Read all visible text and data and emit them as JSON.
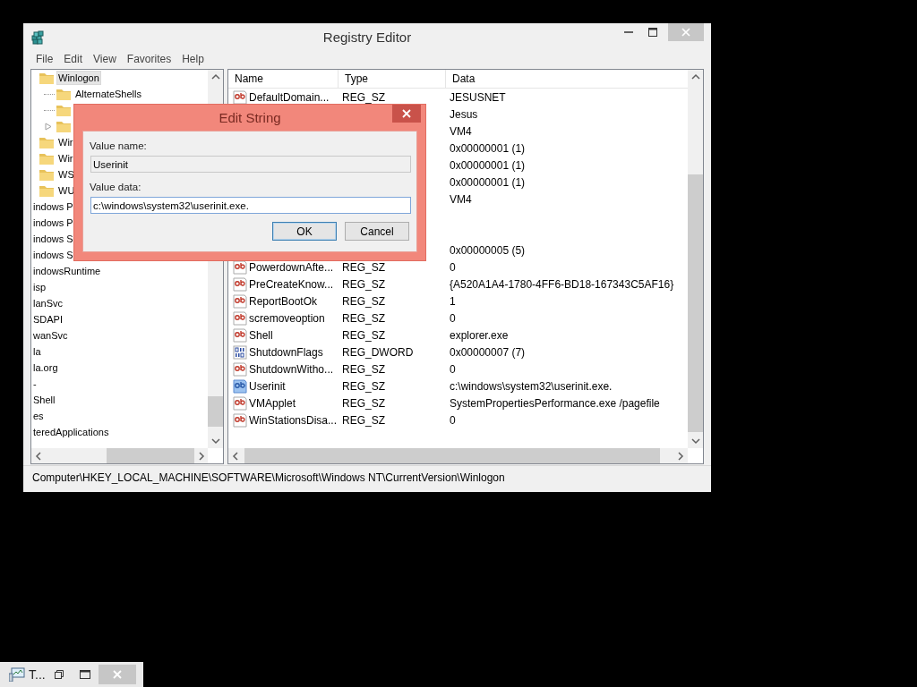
{
  "window": {
    "title": "Registry Editor"
  },
  "menu": [
    "File",
    "Edit",
    "View",
    "Favorites",
    "Help"
  ],
  "tree": {
    "items": [
      {
        "label": "Winlogon",
        "selected": true,
        "children": [
          {
            "label": "AlternateShells",
            "selected": false,
            "expandable": false
          },
          {
            "selected": false,
            "expandable": false
          },
          {
            "selected": false,
            "expandable": true
          }
        ]
      },
      {
        "label": "Wir",
        "selected": false
      },
      {
        "label": "Wir",
        "selected": false
      },
      {
        "label": "WS",
        "selected": false
      },
      {
        "label": "WU",
        "selected": false
      }
    ],
    "outer_items": [
      {
        "label": "indows P",
        "selected": false
      },
      {
        "label": "indows P",
        "selected": false
      },
      {
        "label": "indows S",
        "selected": false
      },
      {
        "label": "indows S",
        "selected": false
      },
      {
        "label": "indowsRuntime",
        "selected": false
      },
      {
        "label": "isp",
        "selected": false
      },
      {
        "label": "lanSvc",
        "selected": false
      },
      {
        "label": "SDAPI",
        "selected": false
      },
      {
        "label": "wanSvc",
        "selected": false
      },
      {
        "label": "la",
        "selected": false
      },
      {
        "label": "la.org",
        "selected": false
      },
      {
        "label": "-",
        "selected": false
      },
      {
        "label": "Shell",
        "selected": false
      },
      {
        "label": "es",
        "selected": false
      },
      {
        "label": "teredApplications",
        "selected": false
      }
    ]
  },
  "list": {
    "columns": [
      "Name",
      "Type",
      "Data"
    ],
    "rows": [
      {
        "kind": "string",
        "name": "DefaultDomain...",
        "type": "REG_SZ",
        "data": "JESUSNET",
        "selected": false
      },
      {
        "data": "Jesus"
      },
      {
        "data": "VM4"
      },
      {
        "data": "0x00000001 (1)"
      },
      {
        "data": "0x00000001 (1)"
      },
      {
        "data": "0x00000001 (1)"
      },
      {
        "data": "VM4"
      },
      {
        "kind": "hidden"
      },
      {
        "kind": "hidden"
      },
      {
        "data": "0x00000005 (5)"
      },
      {
        "kind": "string",
        "name": "PowerdownAfte...",
        "type": "REG_SZ",
        "data": "0",
        "selected": false
      },
      {
        "kind": "string",
        "name": "PreCreateKnow...",
        "type": "REG_SZ",
        "data": "{A520A1A4-1780-4FF6-BD18-167343C5AF16}",
        "selected": false
      },
      {
        "kind": "string",
        "name": "ReportBootOk",
        "type": "REG_SZ",
        "data": "1",
        "selected": false
      },
      {
        "kind": "string",
        "name": "scremoveoption",
        "type": "REG_SZ",
        "data": "0",
        "selected": false
      },
      {
        "kind": "string",
        "name": "Shell",
        "type": "REG_SZ",
        "data": "explorer.exe",
        "selected": false
      },
      {
        "kind": "binary",
        "name": "ShutdownFlags",
        "type": "REG_DWORD",
        "data": "0x00000007 (7)",
        "selected": false
      },
      {
        "kind": "string",
        "name": "ShutdownWitho...",
        "type": "REG_SZ",
        "data": "0",
        "selected": false
      },
      {
        "kind": "string",
        "name": "Userinit",
        "type": "REG_SZ",
        "data": "c:\\windows\\system32\\userinit.exe.",
        "selected": true
      },
      {
        "kind": "string",
        "name": "VMApplet",
        "type": "REG_SZ",
        "data": "SystemPropertiesPerformance.exe /pagefile",
        "selected": false
      },
      {
        "kind": "string",
        "name": "WinStationsDisa...",
        "type": "REG_SZ",
        "data": "0",
        "selected": false
      }
    ]
  },
  "status_bar": "Computer\\HKEY_LOCAL_MACHINE\\SOFTWARE\\Microsoft\\Windows NT\\CurrentVersion\\Winlogon",
  "dialog": {
    "title": "Edit String",
    "fields": [
      {
        "label": "Value name:",
        "value": "Userinit",
        "readonly": true
      },
      {
        "label": "Value data:",
        "value": "c:\\windows\\system32\\userinit.exe.",
        "readonly": false
      }
    ],
    "buttons": [
      {
        "label": "OK",
        "default": true
      },
      {
        "label": "Cancel",
        "default": false
      }
    ]
  },
  "taskbar": {
    "title": "T..."
  }
}
